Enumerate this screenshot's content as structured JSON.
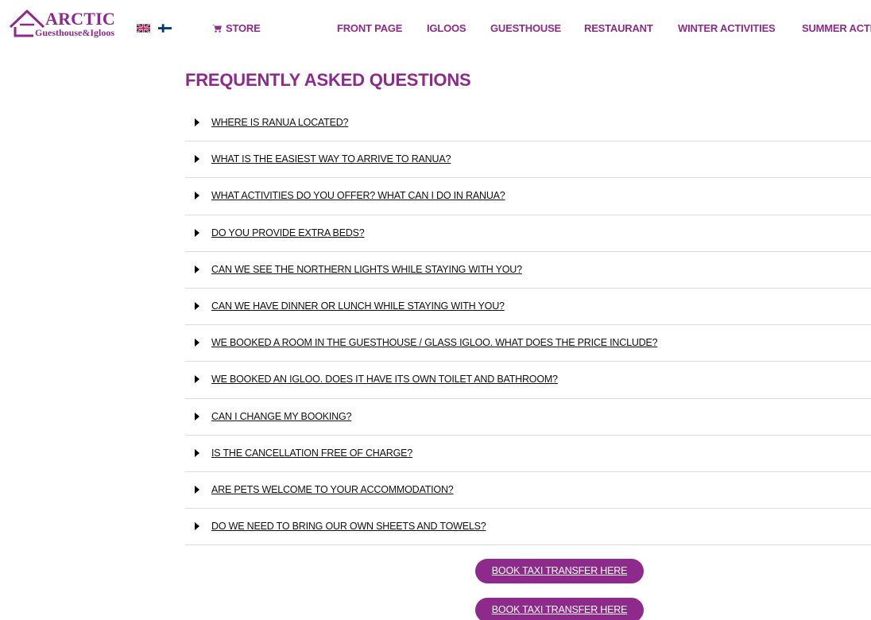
{
  "brand": {
    "name": "ARCTIC",
    "tagline": "Guesthouse&Igloos",
    "color": "#8e2a8c"
  },
  "languages": [
    {
      "code": "en",
      "icon": "uk-flag-icon"
    },
    {
      "code": "fi",
      "icon": "finland-flag-icon"
    }
  ],
  "nav": {
    "store": "STORE",
    "items": [
      "FRONT PAGE",
      "IGLOOS",
      "GUESTHOUSE",
      "RESTAURANT",
      "WINTER ACTIVITIES",
      "SUMMER ACTI"
    ]
  },
  "page": {
    "title": "FREQUENTLY ASKED QUESTIONS"
  },
  "faq": [
    "WHERE IS RANUA LOCATED?",
    "WHAT IS THE EASIEST WAY TO ARRIVE TO RANUA?",
    "WHAT ACTIVITIES DO YOU OFFER? WHAT CAN I DO IN RANUA?",
    "DO YOU PROVIDE EXTRA BEDS?",
    "CAN WE SEE THE NORTHERN LIGHTS WHILE STAYING WITH YOU?",
    "CAN WE HAVE DINNER OR LUNCH WHILE STAYING WITH YOU?",
    "WE BOOKED A ROOM IN THE GUESTHOUSE / GLASS IGLOO. WHAT DOES THE PRICE INCLUDE?",
    "WE BOOKED AN IGLOO. DOES IT HAVE ITS OWN TOILET AND BATHROOM?",
    "CAN I CHANGE MY BOOKING?",
    "IS THE CANCELLATION FREE OF CHARGE?",
    "ARE PETS WELCOME TO YOUR ACCOMMODATION?",
    "DO WE NEED TO BRING OUR OWN SHEETS AND TOWELS?"
  ],
  "buttons": {
    "taxi_1": "BOOK TAXI TRANSFER HERE",
    "taxi_2": "BOOK TAXI TRANSFER HERE"
  }
}
